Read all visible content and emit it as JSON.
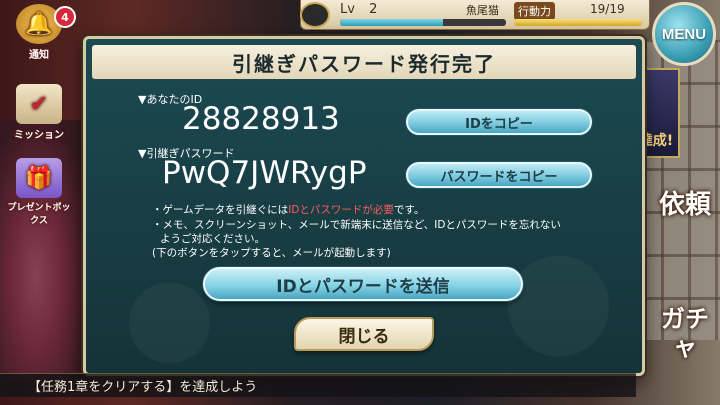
{
  "hud": {
    "level_label": "Lv",
    "level_value": "2",
    "player_name": "魚尾猫",
    "ap_label": "行動力",
    "ap_value": "19/19",
    "menu_label": "MENU"
  },
  "side_menu": {
    "notice_label": "通知",
    "notice_badge": "4",
    "mission_label": "ミッション",
    "present_label": "プレゼントボックス"
  },
  "right_menu": {
    "event_label": "達成!",
    "request_label": "依頼",
    "gacha_label": "ガチャ"
  },
  "dialog": {
    "title": "引継ぎパスワード発行完了",
    "id_label": "▼あなたのID",
    "id_value": "28828913",
    "copy_id_button": "IDをコピー",
    "password_label": "▼引継ぎパスワード",
    "password_value": "PwQ7JWRygP",
    "copy_password_button": "パスワードをコピー",
    "note1_prefix": "・ゲームデータを引継ぐには",
    "note1_highlight": "IDとパスワードが必要",
    "note1_suffix": "です。",
    "note2_line1": "・メモ、スクリーンショット、メールで新端末に送信など、IDとパスワードを忘れない",
    "note2_line2": "ようご対応ください。",
    "note3": "(下のボタンをタップすると、メールが起動します)",
    "send_button": "IDとパスワードを送信",
    "close_button": "閉じる"
  },
  "mission_bar": {
    "text": "【任務1章をクリアする】を達成しよう"
  }
}
